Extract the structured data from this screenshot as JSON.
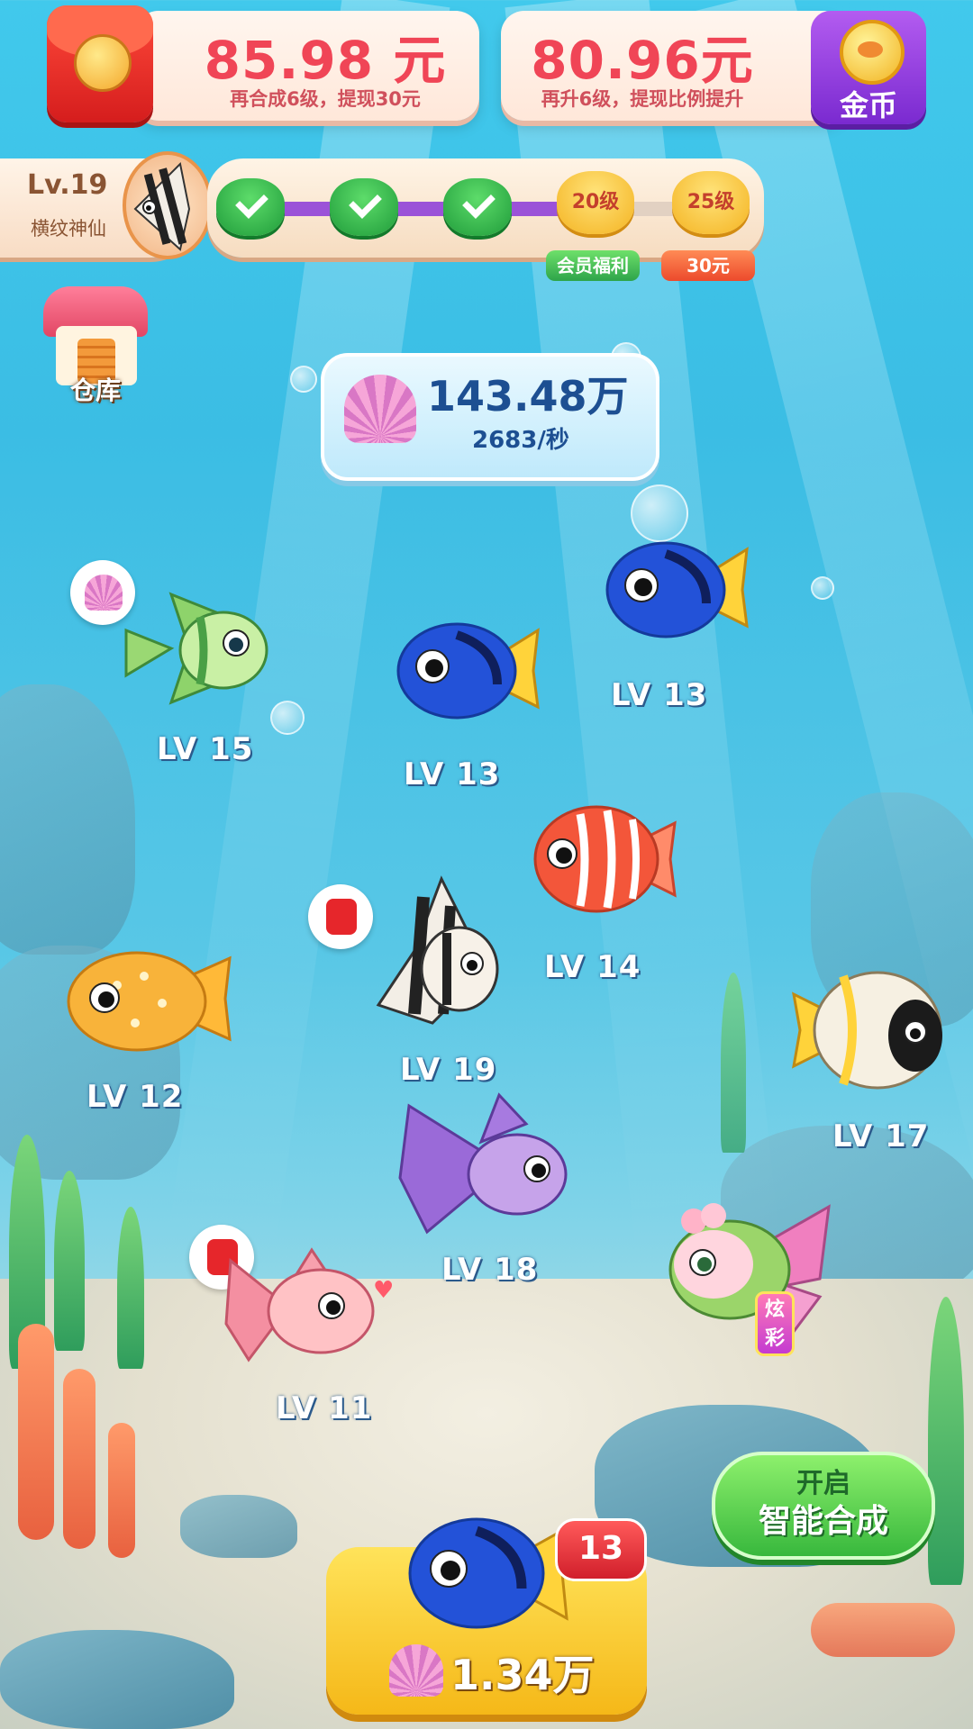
{
  "header": {
    "red_packet": {
      "amount": "85.98 元",
      "note": "再合成6级，提现30元"
    },
    "coins": {
      "amount": "80.96元",
      "note": "再升6级，提现比例提升",
      "button_label": "金币"
    }
  },
  "level": {
    "level_label": "Lv.19",
    "fish_name": "横纹神仙",
    "milestone_20": "20级",
    "milestone_25": "25级",
    "milestone_20_tag": "会员福利",
    "milestone_25_tag": "30元",
    "progress_fraction": 0.78
  },
  "warehouse": {
    "label": "仓库"
  },
  "shells": {
    "amount": "143.48万",
    "rate": "2683/秒"
  },
  "fish": [
    {
      "label": "LV 15"
    },
    {
      "label": "LV 13"
    },
    {
      "label": "LV 13"
    },
    {
      "label": "LV 14"
    },
    {
      "label": "LV 19"
    },
    {
      "label": "LV 12"
    },
    {
      "label": "LV 17"
    },
    {
      "label": "LV 18"
    },
    {
      "label": "LV 11"
    }
  ],
  "special_fish": {
    "tag": "炫彩"
  },
  "smart_merge": {
    "line1": "开启",
    "line2": "智能合成"
  },
  "buy": {
    "count": "13",
    "cost": "1.34万"
  },
  "colors": {
    "accent_red": "#f04556",
    "purple": "#9b52d8",
    "green": "#38b83d",
    "yellow": "#f5b818"
  },
  "icons": [
    "red-packet-icon",
    "gold-coin-icon",
    "check-icon",
    "medal-icon",
    "house-icon",
    "shell-icon",
    "heart-icon"
  ]
}
